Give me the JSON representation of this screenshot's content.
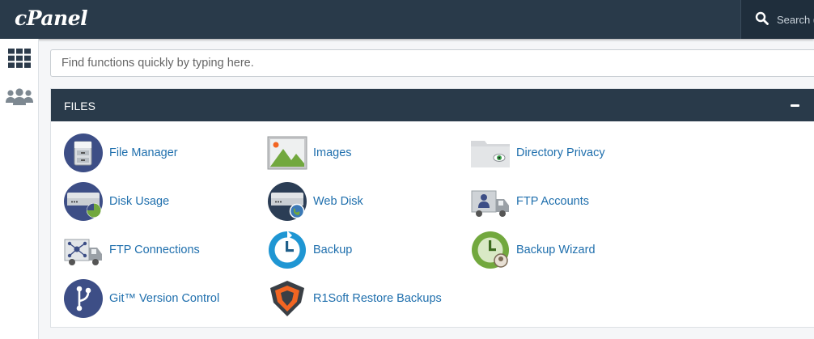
{
  "header": {
    "logo": "cPanel",
    "search_placeholder": "Search ("
  },
  "sidebar": {
    "items": [
      {
        "name": "grid-icon"
      },
      {
        "name": "users-icon"
      }
    ]
  },
  "quick_find": {
    "placeholder": "Find functions quickly by typing here."
  },
  "files_panel": {
    "title": "FILES",
    "items": [
      {
        "label": "File Manager",
        "icon": "file-manager-icon"
      },
      {
        "label": "Images",
        "icon": "images-icon"
      },
      {
        "label": "Directory Privacy",
        "icon": "directory-privacy-icon"
      },
      {
        "label": "Disk Usage",
        "icon": "disk-usage-icon"
      },
      {
        "label": "Web Disk",
        "icon": "web-disk-icon"
      },
      {
        "label": "FTP Accounts",
        "icon": "ftp-accounts-icon"
      },
      {
        "label": "FTP Connections",
        "icon": "ftp-connections-icon"
      },
      {
        "label": "Backup",
        "icon": "backup-icon"
      },
      {
        "label": "Backup Wizard",
        "icon": "backup-wizard-icon"
      },
      {
        "label": "Git™ Version Control",
        "icon": "git-version-control-icon"
      },
      {
        "label": "R1Soft Restore Backups",
        "icon": "r1soft-restore-backups-icon"
      }
    ]
  },
  "colors": {
    "header_bg": "#293a4a",
    "link": "#1f6fad"
  }
}
